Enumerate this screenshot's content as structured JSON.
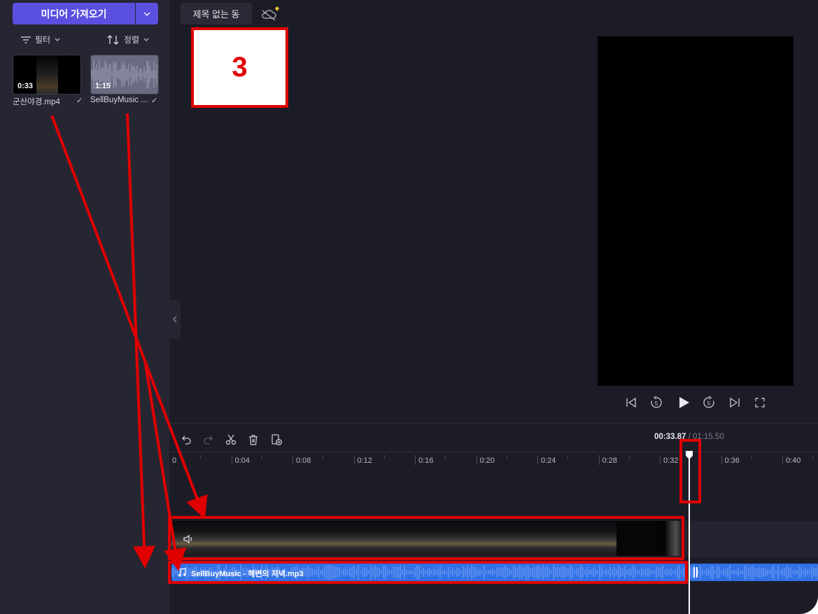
{
  "sidebar": {
    "import_label": "미디어 가져오기",
    "filter_label": "필터",
    "sort_label": "정렬",
    "media": [
      {
        "name": "군산야경.mp4",
        "duration": "0:33"
      },
      {
        "name": "SellBuyMusic ...",
        "duration": "1:15"
      }
    ]
  },
  "header": {
    "project_title": "제목 없는 동"
  },
  "timeline": {
    "current_time": "00:33.87",
    "total_time": "/ 01:15.50",
    "ruler_labels": [
      "0",
      "0:04",
      "0:08",
      "0:12",
      "0:16",
      "0:20",
      "0:24",
      "0:28",
      "0:32",
      "0:36",
      "0:40"
    ],
    "audio_clip_name": "SellBuyMusic - 해변의 저녁.mp3"
  },
  "annotation": {
    "step_number": "3",
    "color": "#e00000"
  },
  "colors": {
    "accent": "#5b4fe0",
    "audio_clip": "#3171e6",
    "background": "#1c1c27",
    "sidebar": "#262633"
  }
}
